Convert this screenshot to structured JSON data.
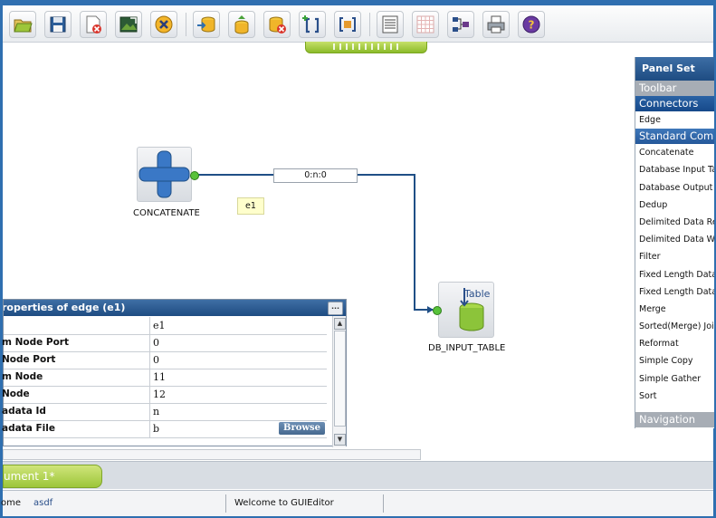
{
  "colors": {
    "frame": "#2f6fb0",
    "panel_header": "#1e4c82",
    "accent_green": "#9dc63a",
    "edge_line": "#1f4f86"
  },
  "toolbar": {
    "buttons": [
      {
        "name": "open-icon"
      },
      {
        "name": "save-icon"
      },
      {
        "name": "close-file-icon"
      },
      {
        "name": "export-icon"
      },
      {
        "name": "cancel-icon"
      },
      {
        "name": "import-db-icon"
      },
      {
        "name": "upload-db-icon"
      },
      {
        "name": "delete-db-icon"
      },
      {
        "name": "add-bracket-icon"
      },
      {
        "name": "bracket-block-icon"
      },
      {
        "name": "list-view-icon"
      },
      {
        "name": "grid-icon"
      },
      {
        "name": "graph-layout-icon"
      },
      {
        "name": "print-icon"
      },
      {
        "name": "help-icon"
      }
    ]
  },
  "canvas": {
    "nodes": {
      "concatenate": {
        "label": "CONCATENATE"
      },
      "db_input": {
        "label": "DB_INPUT_TABLE",
        "icon_text": "Table"
      }
    },
    "edge": {
      "label": "0:n:0",
      "id": "e1"
    }
  },
  "panel_set": {
    "title": "Panel Set",
    "sections": {
      "toolbar": "Toolbar",
      "connectors": "Connectors",
      "standard": "Standard Comp",
      "navigation": "Navigation"
    },
    "connector_items": [
      "Edge"
    ],
    "standard_items": [
      "Concatenate",
      "Database Input Ta",
      "Database Output T",
      "Dedup",
      "Delimited Data Re",
      "Delimited Data Wri",
      "Filter",
      "Fixed Length Data",
      "Fixed Length Data",
      "Merge",
      "Sorted(Merge) Joir",
      "Reformat",
      "Simple Copy",
      "Simple Gather",
      "Sort"
    ]
  },
  "properties": {
    "title": "roperties of edge (e1)",
    "menu_label": "...",
    "browse_label": "Browse",
    "rows": [
      {
        "name": "",
        "value": "e1"
      },
      {
        "name": "m Node Port",
        "value": "0"
      },
      {
        "name": "Node Port",
        "value": "0"
      },
      {
        "name": "m Node",
        "value": "11"
      },
      {
        "name": "Node",
        "value": "12"
      },
      {
        "name": "adata Id",
        "value": "n"
      },
      {
        "name": "adata File",
        "value": "b"
      }
    ]
  },
  "tabs": {
    "document": "ument 1*"
  },
  "status": {
    "left": "ome",
    "user": "asdf",
    "message": "Welcome to GUIEditor"
  }
}
